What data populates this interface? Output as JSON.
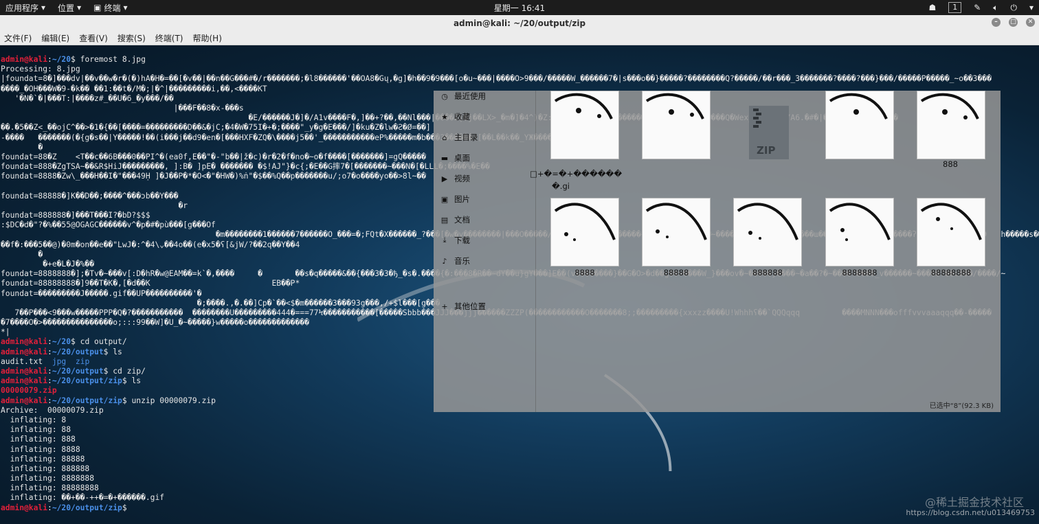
{
  "topbar": {
    "apps_menu": "应用程序",
    "places_menu": "位置",
    "terminal_menu": "终端",
    "clock": "星期一 16:41",
    "workspace": "1"
  },
  "window": {
    "title": "admin@kali: ~/20/output/zip",
    "menus": [
      "文件(F)",
      "编辑(E)",
      "查看(V)",
      "搜索(S)",
      "终端(T)",
      "帮助(H)"
    ]
  },
  "terminal": {
    "lines": [
      [
        {
          "t": "admin@kali",
          "c": "u"
        },
        {
          "t": ":"
        },
        {
          "t": "~/20",
          "c": "p"
        },
        {
          "t": "$ foremost 8.jpg"
        }
      ],
      [
        {
          "t": "Processing: 8.jpg"
        }
      ],
      [
        {
          "t": "|foundat=8�]���dv|��v��w�r�(�)hA�H�=��[�v��|��n��G���#�/r�������;�l8������'��OA8�Gų,�g]�h��9�9���[o�u~���|����O>9���/�����W_������7�|s���o��}�����?��������Q?�����/��r���_3�������?����?���}���/�����P�����_~o��3���"
        }
      ],
      [
        {
          "t": "����_�OH���W�9-�k�� ��1:��t�/M�;|�^|���������i,��,<����KT"
        }
      ],
      [
        {
          "t": "   '�N�`�|���T:|����z#_��U�6_�y���/��"
        }
      ],
      [
        {
          "t": "                                     |���F��8�x-���s"
        }
      ],
      [
        {
          "t": "                                                     �E/������J�]�/A1v����F�,]��+?��,��Nl���|����Z|�j��LX>_�m�]�4^)�Z:�y��M������s�s������.�v?�w�|�x-�[����Q�Wex_����tN�/A6.�#�|�~���V�J�<#_�jE�"
        }
      ],
      [
        {
          "t": "��.�5��Z<_��ojC^��>�1�{��[����=���������D��&�jC;�4�W�75I�+�;����\"_y�g�E���/]�ku�Z�lw�Ƨ�Ø=��]"
        }
      ],
      [
        {
          "t": "-����   �������(�{g�s��|Y�����!��(i���j��d9�en�[���HXF�ZQ�\\����j5��'_�����������eP%�����m�b���3������>[��L��k��_YЖ����_I����F�r"
        }
      ],
      [
        {
          "t": "        �"
        }
      ],
      [
        {
          "t": "foundat=88�Z    <T��c��6B���0��PI^�(ea0f,E��\"�-\"b��|ž�c)�r�2�f�no�~o�f����[�������]=gQ�����"
        }
      ],
      [
        {
          "t": "foundat=888�ZgTSA~��&R$HiJ���������, ]:B� ]pE� ������� �$!AJ\"}�c{;�E��G摔7�[�������~���N�[�LLL�;����%�E��"
        }
      ],
      [
        {
          "t": "foundat=8888�Zw\\_���H��I�\"���49Ḥ ]�J��P�*�O<�\"�HW�)%ṅ\"�$��%Q��p�������u/;o7�o����yo��>8l~��"
        }
      ],
      [
        {
          "t": " "
        }
      ],
      [
        {
          "t": "foundat=88888�]K��D��;����^���ɔb��Y���"
        }
      ],
      [
        {
          "t": "                                      �r"
        }
      ],
      [
        {
          "t": "foundat=888888�]���T���I?�bD?$$$"
        }
      ],
      [
        {
          "t": ":$DC�d�\"?�%��55@OGAGC������v^�p�#�pù���[g���Of"
        }
      ],
      [
        {
          "t": "                                              �m��������1������7������O_���=�;FQt�X������_?���[�w�y��������|���O�����/�8~��3�������_�����~{�������~8����~������?�8���k��E�z���ɯ��������?�8����u����ʔ��?�g �[�w��k�9   h�����s��"
        }
      ],
      [
        {
          "t": "��f�:���5��@)�0m�on��e��\"LwJ�:^�4\\⌄��4o��(e�x5�ʕ[&jW/?��2q��Y��4"
        }
      ],
      [
        {
          "t": "        �"
        }
      ],
      [
        {
          "t": "         �+e�L�J�%��"
        }
      ],
      [
        {
          "t": "foundat=8888888�];�Tv�~���v[:D�hR�w@EAM��=k`�,����     �       ��s�q�����&��{���3�3�ђ_�s�.����{�:���8�R��~dY��u}gY���]E��(v��������}��G�O>�d��g��>����W_}���ov�~�����}����~�a��?�~����?����_v������~�����?��c���/����/~"
        }
      ],
      [
        {
          "t": "foundat=88888888�]9��T�K�,[�d��K                          EB��P*"
        }
      ],
      [
        {
          "t": "foundat=���������J�����.gif��UP����������'�"
        }
      ],
      [
        {
          "t": "                                          �;����.,�.��]Cp�`��<$�m������3���93g���,/+$l���[g���"
        }
      ],
      [
        {
          "t": "   7��P���<9���w�����PPP�Q�?�����������  ��������U���������444�===77Ϟ�����������[�����Sbbb���JJJ���jjj������ZZZP(������������O�������8;;���������{xxxzz����U!Whhhʕ��`QQQqqq         ����MNNN���offfvvvaaaqqq��-�����"
        }
      ],
      [
        {
          "t": "�7����O�>���������������o;:::99��W]�U_�~�����}w�����o�������������"
        }
      ],
      [
        {
          "t": "*|"
        }
      ],
      [
        {
          "t": "admin@kali",
          "c": "u"
        },
        {
          "t": ":"
        },
        {
          "t": "~/20",
          "c": "p"
        },
        {
          "t": "$ cd output/"
        }
      ],
      [
        {
          "t": "admin@kali",
          "c": "u"
        },
        {
          "t": ":"
        },
        {
          "t": "~/20/output",
          "c": "p"
        },
        {
          "t": "$ ls"
        }
      ],
      [
        {
          "t": "audit.txt  "
        },
        {
          "t": "jpg",
          "c": "blue"
        },
        {
          "t": "  "
        },
        {
          "t": "zip",
          "c": "blue"
        }
      ],
      [
        {
          "t": "admin@kali",
          "c": "u"
        },
        {
          "t": ":"
        },
        {
          "t": "~/20/output",
          "c": "p"
        },
        {
          "t": "$ cd zip/"
        }
      ],
      [
        {
          "t": "admin@kali",
          "c": "u"
        },
        {
          "t": ":"
        },
        {
          "t": "~/20/output/zip",
          "c": "p"
        },
        {
          "t": "$ ls"
        }
      ],
      [
        {
          "t": "00000079.zip",
          "c": "red"
        }
      ],
      [
        {
          "t": "admin@kali",
          "c": "u"
        },
        {
          "t": ":"
        },
        {
          "t": "~/20/output/zip",
          "c": "p"
        },
        {
          "t": "$ unzip 00000079.zip"
        }
      ],
      [
        {
          "t": "Archive:  00000079.zip"
        }
      ],
      [
        {
          "t": "  inflating: 8"
        }
      ],
      [
        {
          "t": "  inflating: 88"
        }
      ],
      [
        {
          "t": "  inflating: 888"
        }
      ],
      [
        {
          "t": "  inflating: 8888"
        }
      ],
      [
        {
          "t": "  inflating: 88888"
        }
      ],
      [
        {
          "t": "  inflating: 888888"
        }
      ],
      [
        {
          "t": "  inflating: 8888888"
        }
      ],
      [
        {
          "t": "  inflating: 88888888"
        }
      ],
      [
        {
          "t": "  inflating: ��+��-++�=�+������.gif"
        }
      ],
      [
        {
          "t": "admin@kali",
          "c": "u"
        },
        {
          "t": ":"
        },
        {
          "t": "~/20/output/zip",
          "c": "p"
        },
        {
          "t": "$ "
        }
      ]
    ]
  },
  "file_manager": {
    "sidebar": [
      {
        "label": "最近使用",
        "icon": "clock-icon",
        "glyph": "◷"
      },
      {
        "label": "收藏",
        "icon": "star-icon",
        "glyph": "★"
      },
      {
        "label": "主目录",
        "icon": "home-icon",
        "glyph": "⌂"
      },
      {
        "label": "桌面",
        "icon": "desktop-icon",
        "glyph": "▬"
      },
      {
        "label": "视频",
        "icon": "video-icon",
        "glyph": "▶"
      },
      {
        "label": "图片",
        "icon": "picture-icon",
        "glyph": "▣"
      },
      {
        "label": "文档",
        "icon": "document-icon",
        "glyph": "▤"
      },
      {
        "label": "下载",
        "icon": "download-icon",
        "glyph": "⤓"
      },
      {
        "label": "音乐",
        "icon": "music-icon",
        "glyph": "♪"
      },
      {
        "label": "其他位置",
        "icon": "plus-icon",
        "glyph": "+"
      }
    ],
    "row1_labels": [
      "",
      "",
      "",
      "",
      "888"
    ],
    "zip_label": "ZIP",
    "row1_extra_labels": [
      "□+�=�+������",
      "�.gi"
    ],
    "row2_labels": [
      "8888",
      "88888",
      "888888",
      "8888888",
      "88888888"
    ],
    "status": "已选中“8”(92.3 KB)"
  },
  "watermark": {
    "line1": "@稀土掘金技术社区",
    "line2": "https://blog.csdn.net/u013469753"
  }
}
